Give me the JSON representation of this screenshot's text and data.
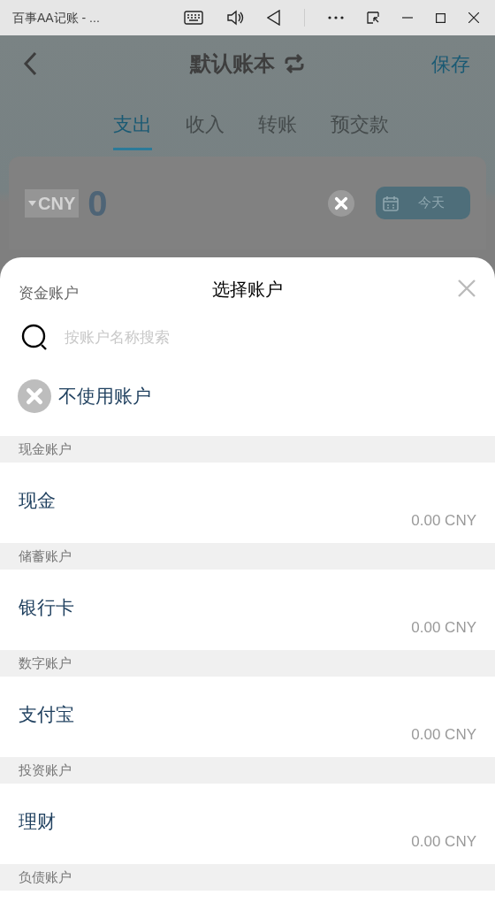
{
  "window": {
    "title": "百事AA记账 - ..."
  },
  "header": {
    "title": "默认账本",
    "save": "保存"
  },
  "tabs": [
    {
      "label": "支出",
      "selected": true
    },
    {
      "label": "收入",
      "selected": false
    },
    {
      "label": "转账",
      "selected": false
    },
    {
      "label": "预交款",
      "selected": false
    }
  ],
  "amount_card": {
    "currency": "CNY",
    "amount": "0",
    "date": "今天"
  },
  "sheet": {
    "label": "资金账户",
    "title": "选择账户",
    "search": {
      "placeholder": "按账户名称搜索"
    },
    "no_account": "不使用账户",
    "groups": [
      {
        "name": "现金账户",
        "accounts": [
          {
            "name": "现金",
            "balance": "0.00 CNY"
          }
        ]
      },
      {
        "name": "储蓄账户",
        "accounts": [
          {
            "name": "银行卡",
            "balance": "0.00 CNY"
          }
        ]
      },
      {
        "name": "数字账户",
        "accounts": [
          {
            "name": "支付宝",
            "balance": "0.00 CNY"
          }
        ]
      },
      {
        "name": "投资账户",
        "accounts": [
          {
            "name": "理财",
            "balance": "0.00 CNY"
          }
        ]
      },
      {
        "name": "负债账户"
      }
    ]
  }
}
